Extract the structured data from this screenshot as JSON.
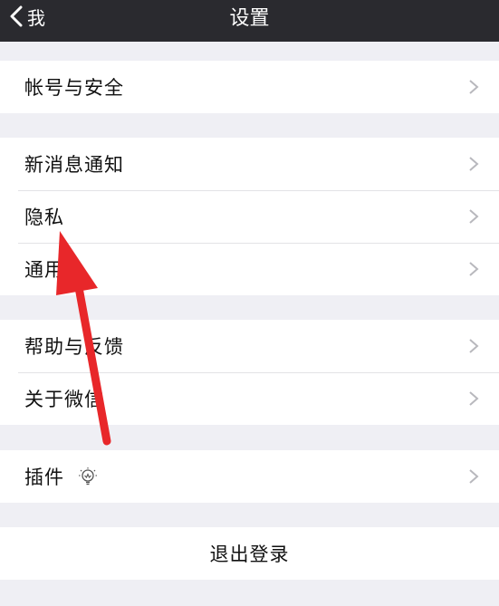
{
  "nav": {
    "back_label": "我",
    "title": "设置"
  },
  "groups": [
    {
      "items": [
        "帐号与安全"
      ]
    },
    {
      "items": [
        "新消息通知",
        "隐私",
        "通用"
      ]
    },
    {
      "items": [
        "帮助与反馈",
        "关于微信"
      ]
    },
    {
      "items": [
        "插件"
      ]
    }
  ],
  "logout_label": "退出登录",
  "colors": {
    "nav_bg": "#2a2a2f",
    "page_bg": "#efeff4",
    "annotation_arrow": "#e8272a"
  },
  "icons": [
    "chevron-left-icon",
    "chevron-right-icon",
    "lightbulb-icon"
  ]
}
